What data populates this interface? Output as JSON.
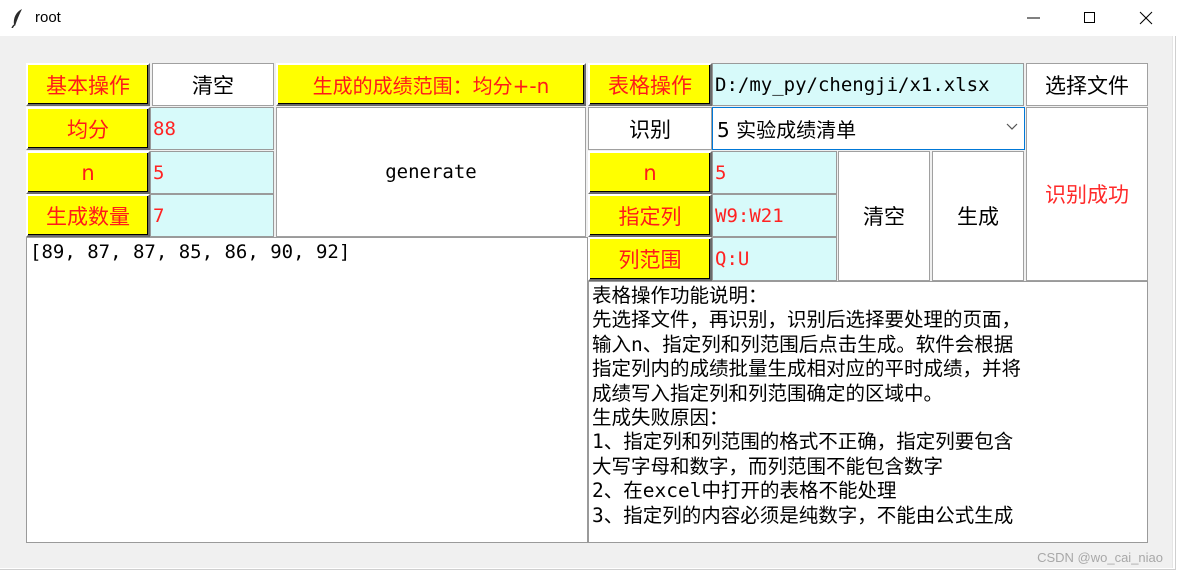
{
  "window": {
    "title": "root",
    "icon": "feather-icon",
    "controls": [
      "minimize-icon",
      "maximize-icon",
      "close-icon"
    ]
  },
  "basic": {
    "header_label": "基本操作",
    "clear_button": "清空",
    "range_label": "生成的成绩范围：均分+-n",
    "avg_label": "均分",
    "avg_value": "88",
    "n_label": "n",
    "n_value": "5",
    "count_label": "生成数量",
    "count_value": "7",
    "generate_button": "generate",
    "output": "[89, 87, 87, 85, 86, 90, 92]"
  },
  "table": {
    "header_label": "表格操作",
    "file_path": "D:/my_py/chengji/x1.xlsx",
    "choose_file_button": "选择文件",
    "identify_button": "识别",
    "sheet_select_value": "5 实验成绩清单",
    "status_text": "识别成功",
    "n_label": "n",
    "n_value": "5",
    "column_label": "指定列",
    "column_value": "W9:W21",
    "range_label": "列范围",
    "range_value": "Q:U",
    "clear_button": "清空",
    "generate_button": "生成",
    "help_lines": [
      "表格操作功能说明：",
      "先选择文件，再识别，识别后选择要处理的页面，",
      "输入n、指定列和列范围后点击生成。软件会根据",
      "指定列内的成绩批量生成相对应的平时成绩，并将",
      "成绩写入指定列和列范围确定的区域中。",
      "生成失败原因：",
      "1、指定列和列范围的格式不正确，指定列要包含",
      "大写字母和数字，而列范围不能包含数字",
      "2、在excel中打开的表格不能处理",
      "3、指定列的内容必须是纯数字，不能由公式生成"
    ]
  },
  "watermark": "CSDN @wo_cai_niao"
}
